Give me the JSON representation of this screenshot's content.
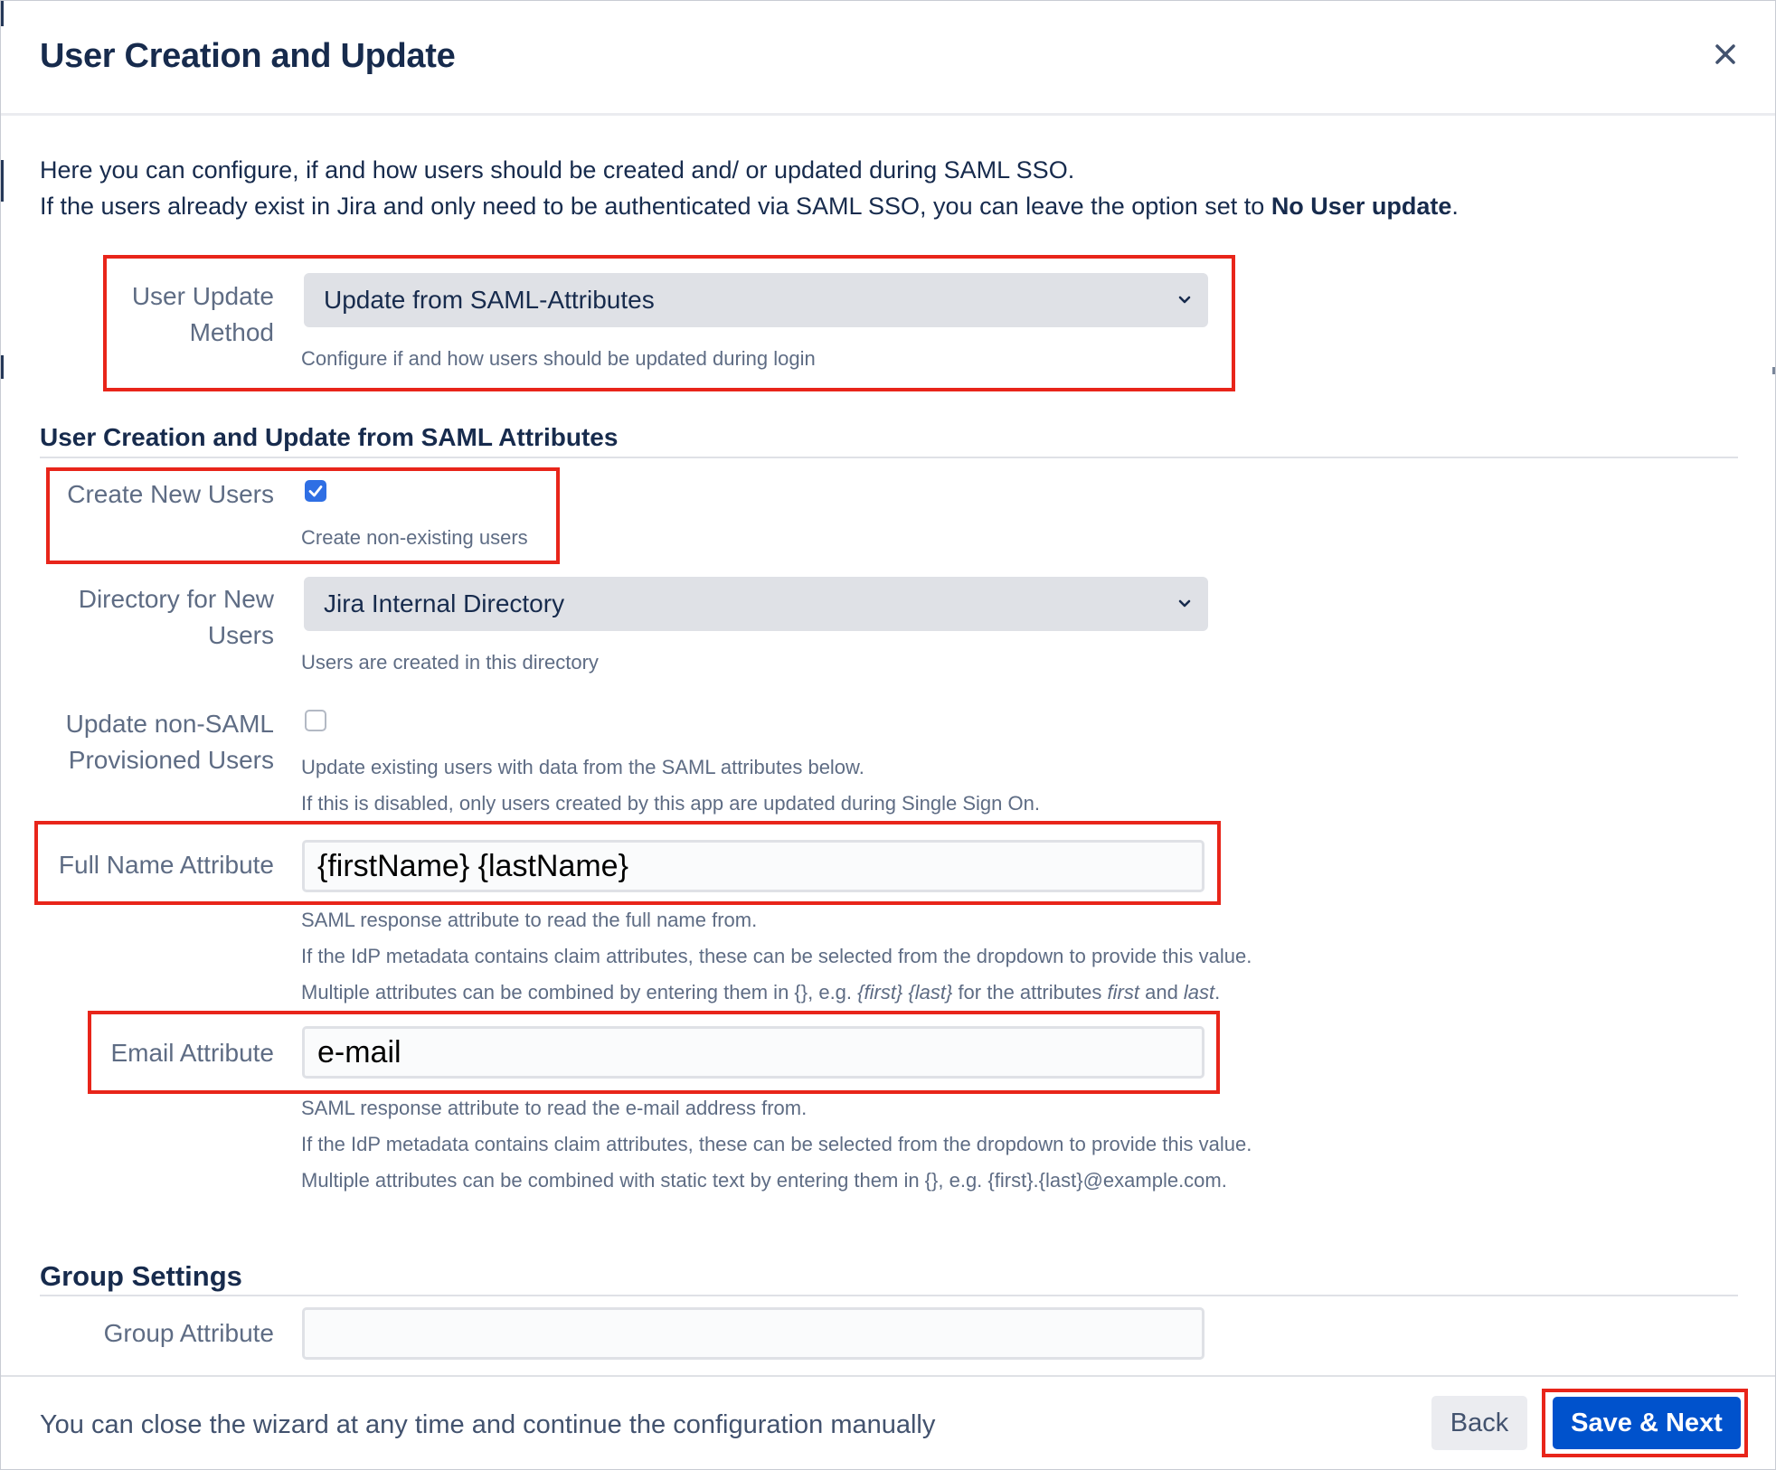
{
  "dialog": {
    "title": "User Creation and Update",
    "close_icon": "close-icon"
  },
  "intro": {
    "line1": "Here you can configure, if and how users should be created and/ or updated during SAML SSO.",
    "line2_prefix": "If the users already exist in Jira and only need to be authenticated via SAML SSO, you can leave the option set to ",
    "line2_bold": "No User update",
    "line2_suffix": "."
  },
  "user_update_method": {
    "label_line1": "User Update",
    "label_line2": "Method",
    "selected": "Update from SAML-Attributes",
    "help": "Configure if and how users should be updated during login"
  },
  "section_saml": {
    "title": "User Creation and Update from SAML Attributes"
  },
  "create_new_users": {
    "label": "Create New Users",
    "checked": true,
    "help": "Create non-existing users"
  },
  "directory": {
    "label_line1": "Directory for New",
    "label_line2": "Users",
    "selected": "Jira Internal Directory",
    "help": "Users are created in this directory"
  },
  "update_non_saml": {
    "label_line1": "Update non-SAML",
    "label_line2": "Provisioned Users",
    "checked": false,
    "help_line1": "Update existing users with data from the SAML attributes below.",
    "help_line2": "If this is disabled, only users created by this app are updated during Single Sign On."
  },
  "full_name": {
    "label": "Full Name Attribute",
    "value": "{firstName} {lastName}",
    "help_line1": "SAML response attribute to read the full name from.",
    "help_line2": "If the IdP metadata contains claim attributes, these can be selected from the dropdown to provide this value.",
    "help_line3_a": "Multiple attributes can be combined by entering them in {}, e.g. ",
    "help_line3_b": "{first} {last}",
    "help_line3_c": " for the attributes ",
    "help_line3_d": "first",
    "help_line3_e": " and ",
    "help_line3_f": "last",
    "help_line3_g": "."
  },
  "email": {
    "label": "Email Attribute",
    "value": "e-mail",
    "help_line1": "SAML response attribute to read the e-mail address from.",
    "help_line2": "If the IdP metadata contains claim attributes, these can be selected from the dropdown to provide this value.",
    "help_line3": "Multiple attributes can be combined with static text by entering them in {}, e.g. {first}.{last}@example.com."
  },
  "section_group": {
    "title": "Group Settings"
  },
  "group_attribute": {
    "label": "Group Attribute",
    "value": ""
  },
  "footer": {
    "text": "You can close the wizard at any time and continue the configuration manually",
    "back_label": "Back",
    "save_label": "Save & Next"
  },
  "colors": {
    "highlight": "#e8251a",
    "primary": "#0052cc",
    "checkbox_checked": "#2f6fe4",
    "text": "#172b4d",
    "muted": "#5e6c84"
  }
}
